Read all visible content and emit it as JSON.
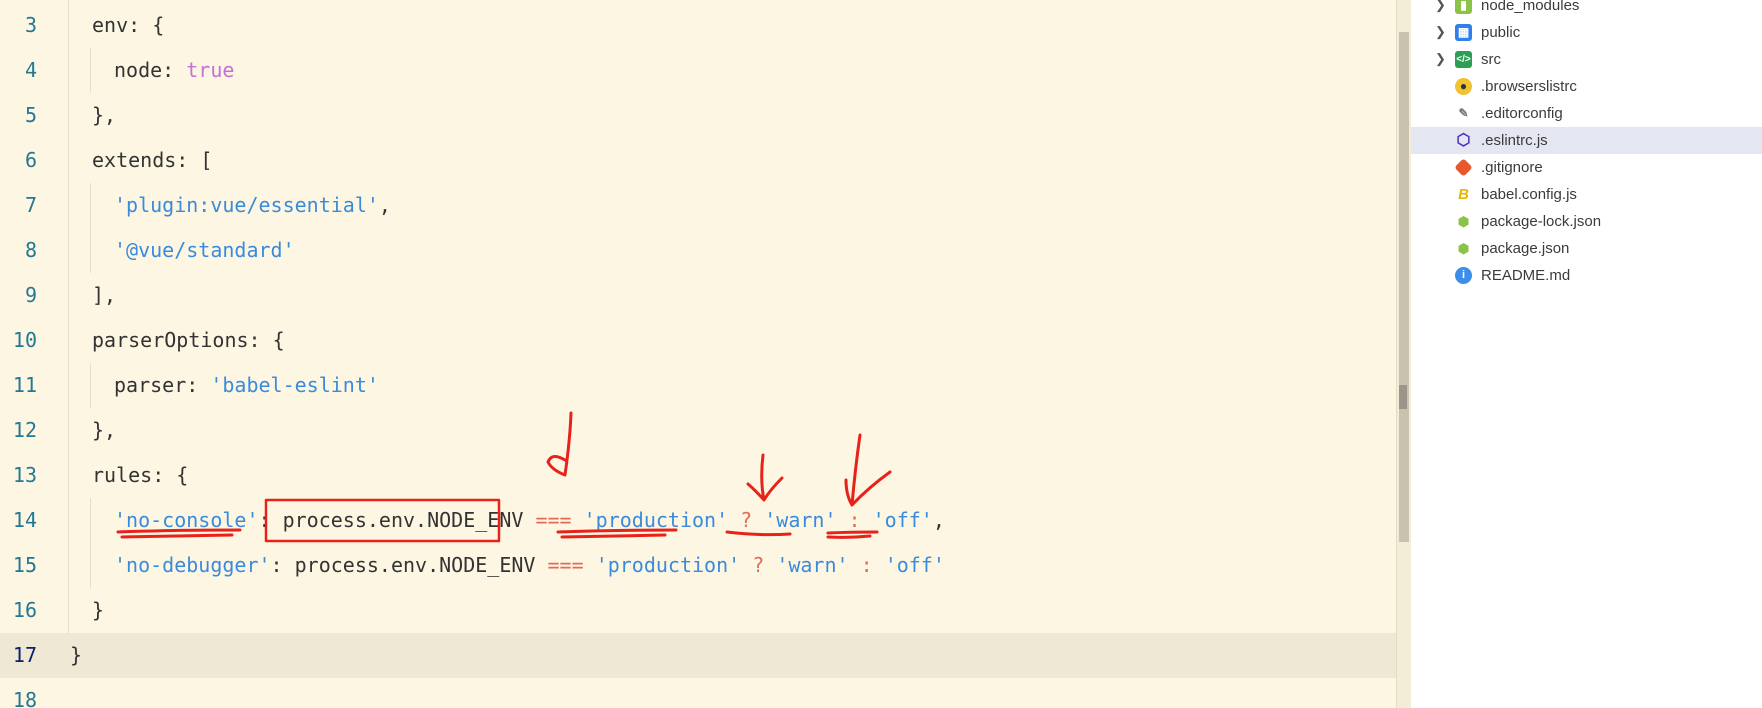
{
  "editor": {
    "line_numbers": [
      "3",
      "4",
      "5",
      "6",
      "7",
      "8",
      "9",
      "10",
      "11",
      "12",
      "13",
      "14",
      "15",
      "16",
      "17",
      "18"
    ],
    "lines": {
      "l3": {
        "a": "env: {"
      },
      "l4": {
        "a": "node: ",
        "b": "true"
      },
      "l5": {
        "a": "},"
      },
      "l6": {
        "a": "extends: ["
      },
      "l7": {
        "a": "'plugin:vue/essential'",
        "b": ","
      },
      "l8": {
        "a": "'@vue/standard'"
      },
      "l9": {
        "a": "],"
      },
      "l10": {
        "a": "parserOptions: {"
      },
      "l11": {
        "a": "parser: ",
        "b": "'babel-eslint'"
      },
      "l12": {
        "a": "},"
      },
      "l13": {
        "a": "rules: {"
      },
      "l14": {
        "key": "'no-console'",
        "colon": ": ",
        "expr": "process.env.NODE_ENV",
        "eq": " === ",
        "prod": "'production'",
        "q": " ? ",
        "warn": "'warn'",
        "c": " : ",
        "off": "'off'",
        "end": ","
      },
      "l15": {
        "key": "'no-debugger'",
        "colon": ": ",
        "expr": "process.env.NODE_ENV",
        "eq": " === ",
        "prod": "'production'",
        "q": " ? ",
        "warn": "'warn'",
        "c": " : ",
        "off": "'off'"
      },
      "l16": {
        "a": "}"
      },
      "l17": {
        "a": "}"
      }
    },
    "active_line": "17"
  },
  "explorer": {
    "items": [
      {
        "label": "node_modules",
        "icon": "folder-node-icon",
        "expandable": true
      },
      {
        "label": "public",
        "icon": "folder-public-icon",
        "expandable": true
      },
      {
        "label": "src",
        "icon": "folder-src-icon",
        "expandable": true
      },
      {
        "label": ".browserslistrc",
        "icon": "browserslist-icon"
      },
      {
        "label": ".editorconfig",
        "icon": "editorconfig-icon"
      },
      {
        "label": ".eslintrc.js",
        "icon": "eslint-icon",
        "selected": true
      },
      {
        "label": ".gitignore",
        "icon": "git-icon"
      },
      {
        "label": "babel.config.js",
        "icon": "babel-icon"
      },
      {
        "label": "package-lock.json",
        "icon": "nodejs-icon"
      },
      {
        "label": "package.json",
        "icon": "nodejs-icon"
      },
      {
        "label": "README.md",
        "icon": "info-icon"
      }
    ]
  },
  "annotations": {
    "handwritten_mark": "d",
    "color": "#e8221b"
  },
  "colors": {
    "background": "#fdf6e3",
    "string": "#3a8bdc",
    "keyword": "#c86fd6",
    "operator": "#e06c5b",
    "line_number": "#237893"
  }
}
